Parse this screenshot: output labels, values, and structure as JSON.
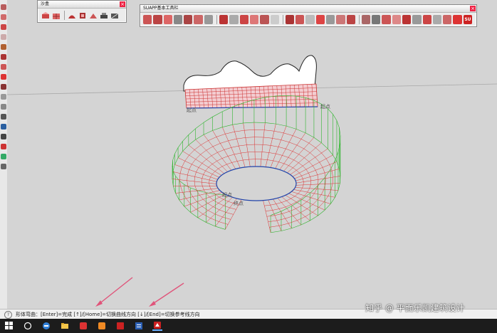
{
  "app": {
    "name": "SketchUp"
  },
  "toolbars": {
    "sandbox": {
      "title": "沙盒"
    },
    "suapp": {
      "title": "SUAPP基本工具栏",
      "end_label": "SU"
    }
  },
  "viewport": {
    "labels": {
      "top_left": "起点",
      "top_right": "起点",
      "inner_start": "起点",
      "inner_end": "终点"
    }
  },
  "status_bar": {
    "help_glyph": "?",
    "message": "形体弯曲：[Enter]=完成 [↑]/[Home]=切换曲线方向 [↓]/[End]=切换参考线方向"
  },
  "watermark": {
    "text": "知乎 @ 平面乐凯建筑设计"
  },
  "taskbar": {
    "items": [
      "start",
      "search",
      "edge",
      "file-explorer",
      "app-red",
      "app-orange",
      "app-jianyin",
      "word",
      "sketchup"
    ]
  }
}
